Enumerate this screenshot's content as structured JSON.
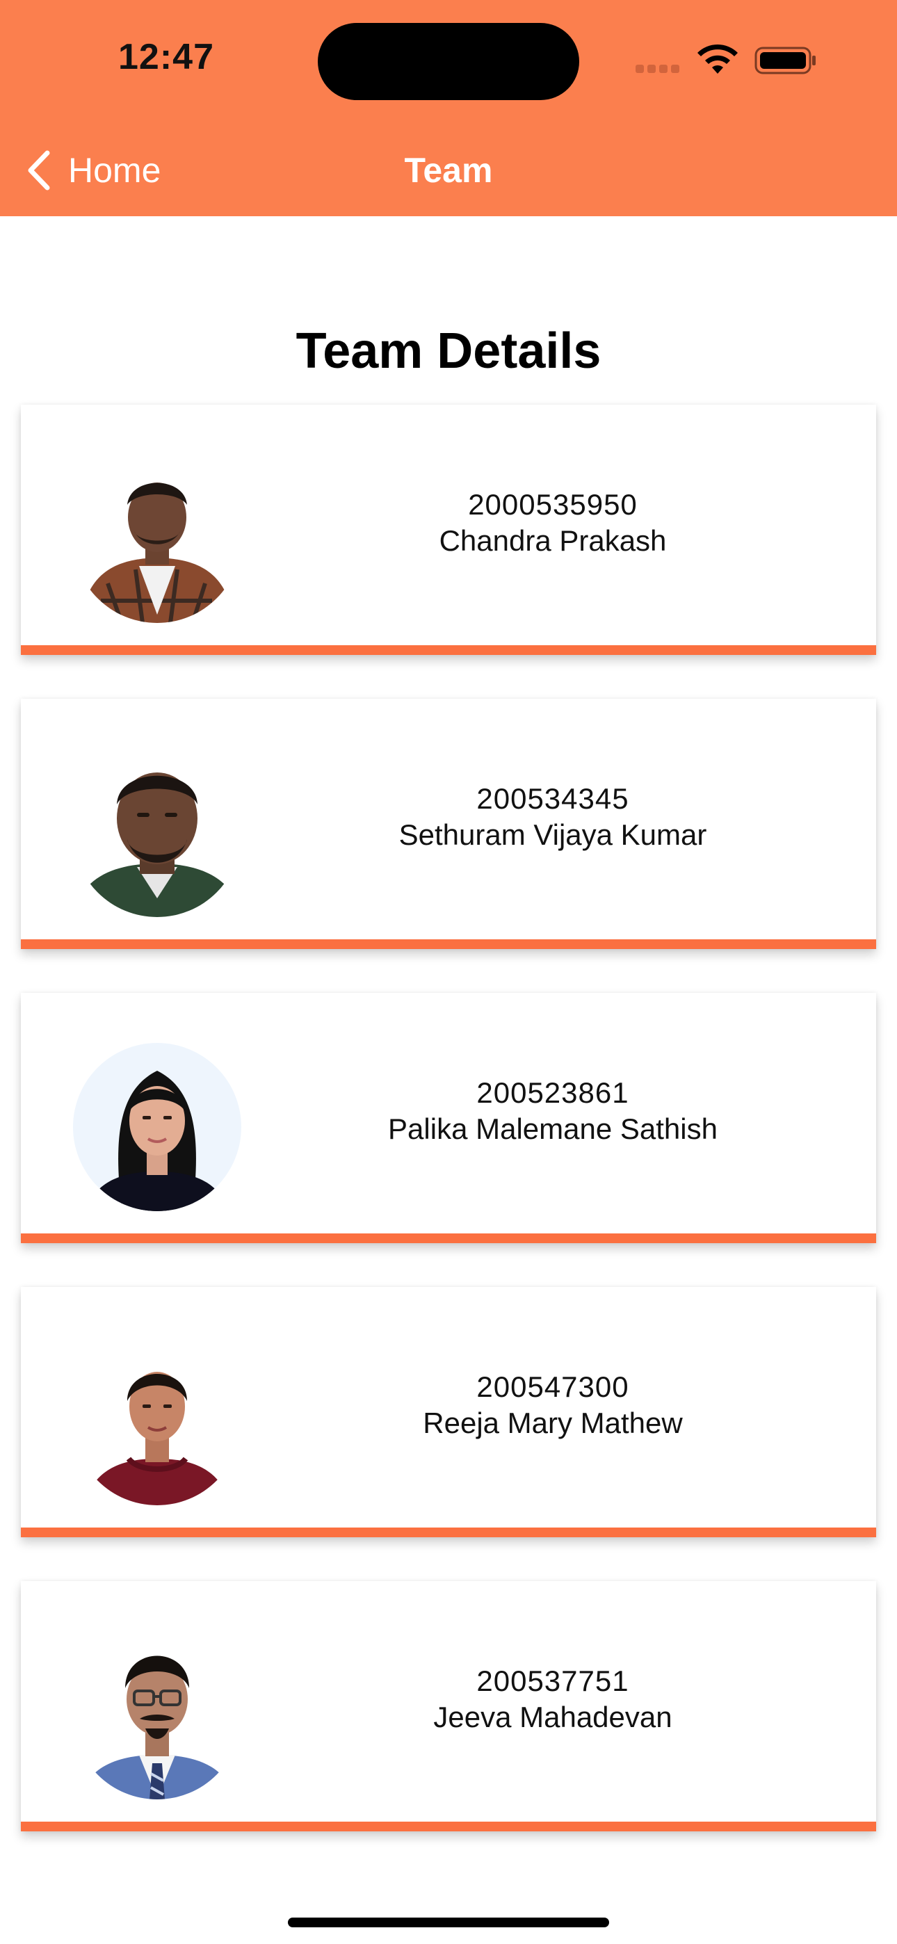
{
  "status_bar": {
    "time": "12:47"
  },
  "nav": {
    "back_label": "Home",
    "title": "Team"
  },
  "page": {
    "heading": "Team Details"
  },
  "team": [
    {
      "id": "2000535950",
      "name": "Chandra Prakash"
    },
    {
      "id": "200534345",
      "name": "Sethuram Vijaya Kumar"
    },
    {
      "id": "200523861",
      "name": "Palika Malemane Sathish"
    },
    {
      "id": "200547300",
      "name": "Reeja Mary Mathew"
    },
    {
      "id": "200537751",
      "name": "Jeeva Mahadevan"
    }
  ],
  "colors": {
    "accent": "#fb7f4e",
    "card_underline": "#fb7040",
    "text": "#111111"
  }
}
